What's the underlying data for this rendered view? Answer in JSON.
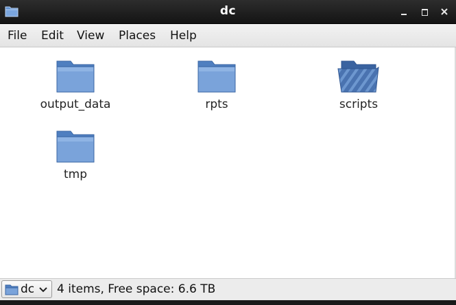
{
  "window": {
    "title": "dc"
  },
  "menubar": {
    "items": [
      {
        "label": "File"
      },
      {
        "label": "Edit"
      },
      {
        "label": "View"
      },
      {
        "label": "Places"
      },
      {
        "label": "Help"
      }
    ]
  },
  "files": [
    {
      "name": "output_data",
      "icon": "folder-icon"
    },
    {
      "name": "rpts",
      "icon": "folder-icon"
    },
    {
      "name": "scripts",
      "icon": "folder-scripts-icon"
    },
    {
      "name": "tmp",
      "icon": "folder-icon"
    }
  ],
  "statusbar": {
    "location": "dc",
    "info": "4 items, Free space: 6.6 TB"
  },
  "colors": {
    "folder_blue": "#6d97cf",
    "folder_dark": "#4a73b0",
    "titlebar": "#1c1c1c"
  }
}
